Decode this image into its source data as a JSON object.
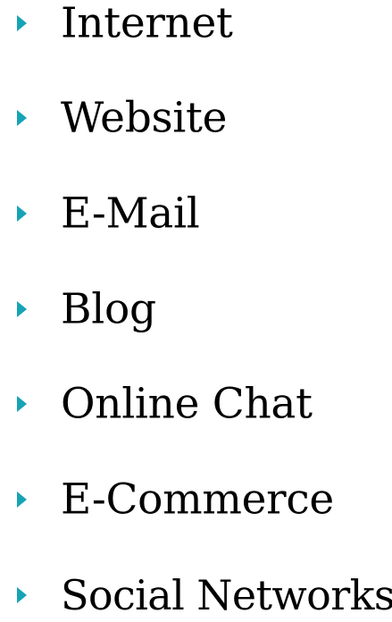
{
  "accent_color": "#17a3b6",
  "bullets": [
    {
      "label": "Internet",
      "icon": "triangle-right-icon"
    },
    {
      "label": "Website",
      "icon": "triangle-right-icon"
    },
    {
      "label": "E-Mail",
      "icon": "triangle-right-icon"
    },
    {
      "label": "Blog",
      "icon": "triangle-right-icon"
    },
    {
      "label": "Online Chat",
      "icon": "triangle-right-icon"
    },
    {
      "label": "E-Commerce",
      "icon": "triangle-right-icon"
    },
    {
      "label": "Social Networks",
      "icon": "triangle-right-icon"
    }
  ]
}
